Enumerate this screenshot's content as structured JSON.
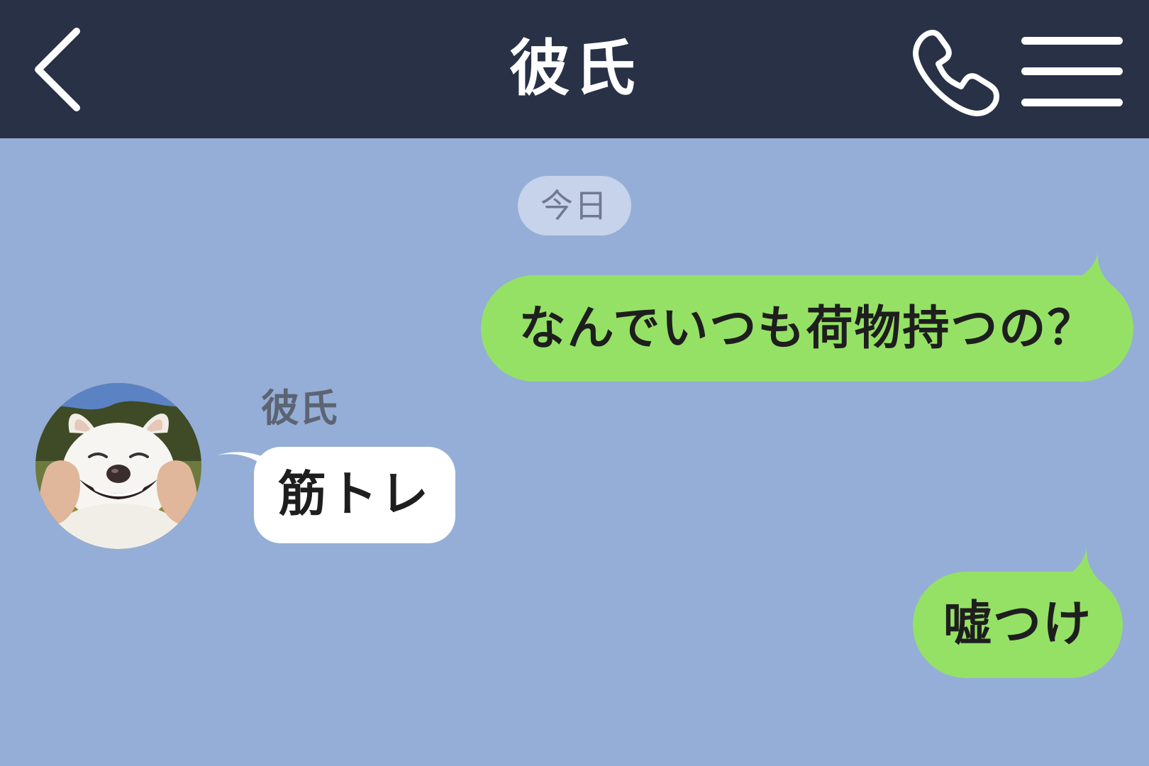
{
  "header": {
    "title": "彼氏"
  },
  "date_separator": "今日",
  "messages": [
    {
      "direction": "outgoing",
      "text": "なんでいつも荷物持つの？"
    },
    {
      "direction": "incoming",
      "sender": "彼氏",
      "text": "筋トレ"
    },
    {
      "direction": "outgoing",
      "text": "嘘つけ"
    }
  ],
  "colors": {
    "header_bg": "#293147",
    "chat_bg": "#95aed7",
    "outgoing_bubble": "#95e165",
    "incoming_bubble": "#ffffff",
    "date_pill": "#c6d3ea"
  },
  "icons": {
    "back": "chevron-left-icon",
    "call": "phone-icon",
    "menu": "hamburger-menu-icon",
    "avatar": "smiling-dog-photo"
  }
}
